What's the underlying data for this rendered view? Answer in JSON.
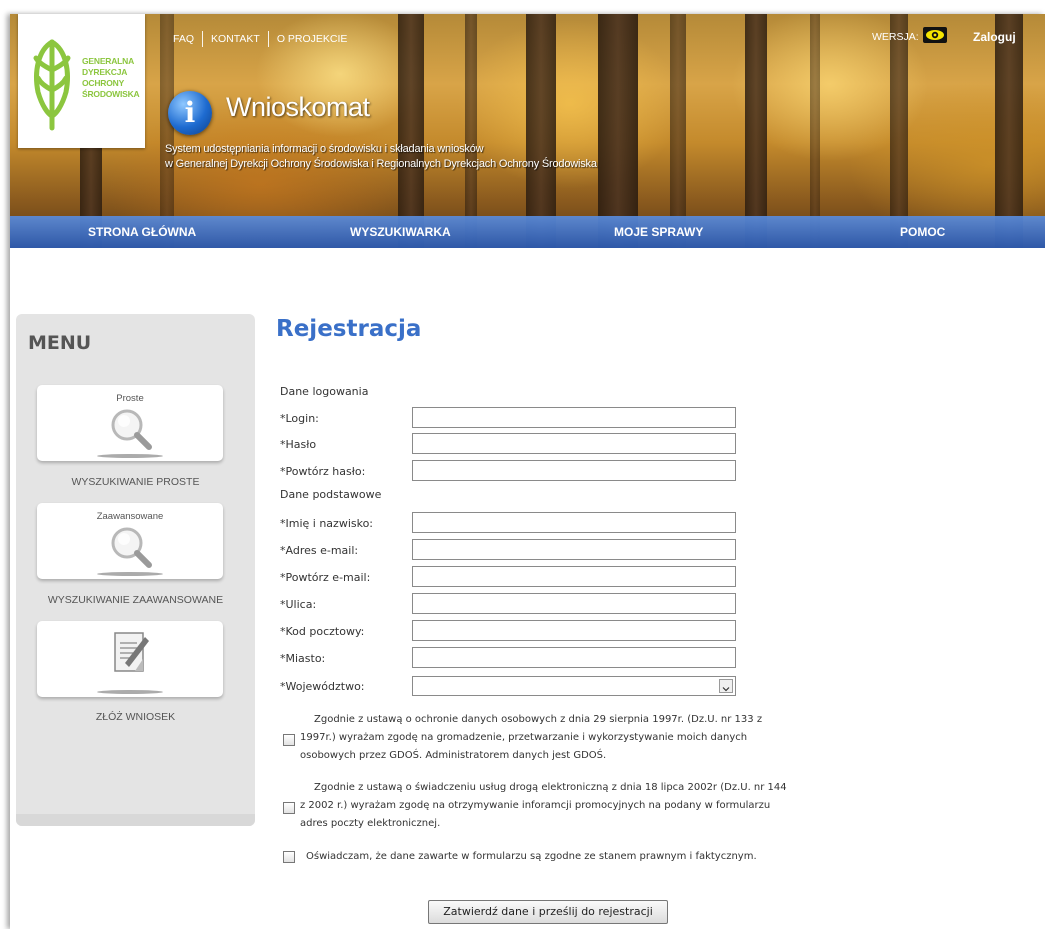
{
  "header": {
    "logo_lines": [
      "GENERALNA",
      "DYREKCJA",
      "OCHRONY",
      "ŚRODOWISKA"
    ],
    "top_links": [
      "FAQ",
      "KONTAKT",
      "O PROJEKCIE"
    ],
    "version_label": "WERSJA:",
    "login": "Zaloguj",
    "app_title": "Wnioskomat",
    "subtitle_line1": "System udostępniania informacji o środowisku i składania wniosków",
    "subtitle_line2": "w Generalnej Dyrekcji Ochrony Środowiska i Regionalnych Dyrekcjach Ochrony Środowiska",
    "nav": [
      "STRONA GŁÓWNA",
      "WYSZUKIWARKA",
      "MOJE SPRAWY",
      "POMOC"
    ]
  },
  "menu": {
    "title": "MENU",
    "items": [
      {
        "caption": "Proste",
        "label": "WYSZUKIWANIE PROSTE",
        "icon": "magnifier-icon"
      },
      {
        "caption": "Zaawansowane",
        "label": "WYSZUKIWANIE ZAAWANSOWANE",
        "icon": "magnifier-icon"
      },
      {
        "caption": "",
        "label": "ZŁÓŻ WNIOSEK",
        "icon": "document-edit-icon"
      }
    ]
  },
  "form": {
    "title": "Rejestracja",
    "section_login": "Dane logowania",
    "section_basic": "Dane podstawowe",
    "fields": {
      "login": "*Login:",
      "password": "*Hasło",
      "password_repeat": "*Powtórz hasło:",
      "name": "*Imię i nazwisko:",
      "email": "*Adres e-mail:",
      "email_repeat": "*Powtórz e-mail:",
      "street": "*Ulica:",
      "postal_code": "*Kod pocztowy:",
      "city": "*Miasto:",
      "voivodeship": "*Województwo:"
    },
    "consent1": [
      "Zgodnie z ustawą o ochronie danych osobowych z dnia 29 sierpnia 1997r. (Dz.U. nr 133 z",
      "1997r.) wyrażam zgodę na gromadzenie, przetwarzanie i wykorzystywanie moich danych",
      "osobowych przez GDOŚ. Administratorem danych jest GDOŚ."
    ],
    "consent2": [
      "Zgodnie z ustawą o świadczeniu usług drogą elektroniczną z dnia 18 lipca 2002r (Dz.U. nr 144",
      "z 2002 r.) wyrażam zgodę na otrzymywanie inforamcji promocyjnych na podany w formularzu",
      "adres poczty elektronicznej."
    ],
    "consent3": "Oświadczam, że dane zawarte w formularzu są zgodne ze stanem prawnym i faktycznym.",
    "submit": "Zatwierdź dane i prześlij do rejestracji"
  },
  "colors": {
    "accent": "#3a70c8",
    "nav_bar": "#3d6cc0",
    "logo_green": "#8cc63f"
  }
}
